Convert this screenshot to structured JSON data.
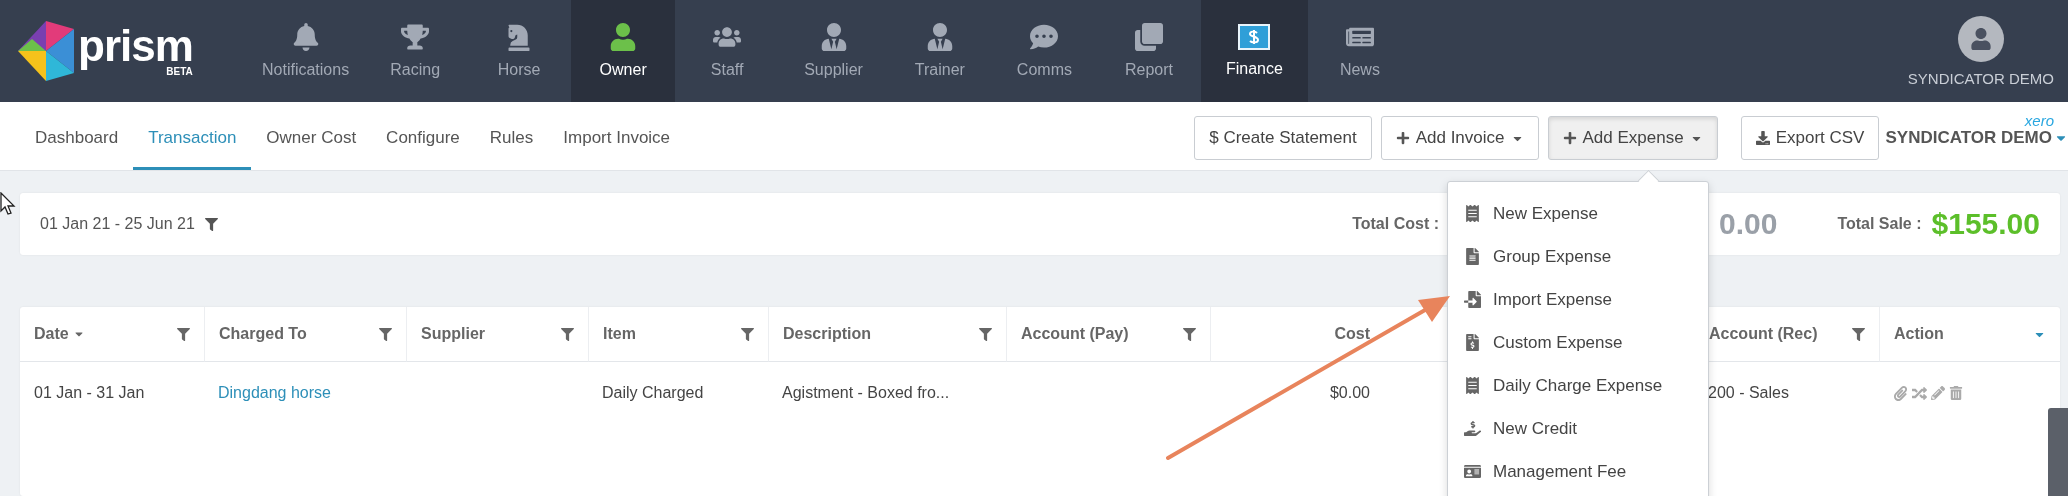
{
  "logo": {
    "name": "prism",
    "badge": "BETA"
  },
  "nav": [
    {
      "label": "Notifications",
      "selected": false
    },
    {
      "label": "Racing",
      "selected": false
    },
    {
      "label": "Horse",
      "selected": false
    },
    {
      "label": "Owner",
      "selected": true
    },
    {
      "label": "Staff",
      "selected": false
    },
    {
      "label": "Supplier",
      "selected": false
    },
    {
      "label": "Trainer",
      "selected": false
    },
    {
      "label": "Comms",
      "selected": false
    },
    {
      "label": "Report",
      "selected": false
    },
    {
      "label": "Finance",
      "selected": true
    },
    {
      "label": "News",
      "selected": false
    }
  ],
  "user": {
    "name": "SYNDICATOR DEMO"
  },
  "tabs": [
    {
      "label": "Dashboard",
      "selected": false
    },
    {
      "label": "Transaction",
      "selected": true
    },
    {
      "label": "Owner Cost",
      "selected": false
    },
    {
      "label": "Configure",
      "selected": false
    },
    {
      "label": "Rules",
      "selected": false
    },
    {
      "label": "Import Invoice",
      "selected": false
    }
  ],
  "actions": [
    {
      "label": "$ Create Statement",
      "kind": "plain",
      "dropdown": false,
      "expanded": false
    },
    {
      "label": "Add Invoice",
      "kind": "add",
      "dropdown": true,
      "expanded": false
    },
    {
      "label": "Add Expense",
      "kind": "add",
      "dropdown": true,
      "expanded": true
    },
    {
      "label": "Export CSV",
      "kind": "export",
      "dropdown": false,
      "expanded": false
    }
  ],
  "xero": {
    "brand": "xero",
    "org": "SYNDICATOR DEMO"
  },
  "expense_menu": [
    "New Expense",
    "Group Expense",
    "Import Expense",
    "Custom Expense",
    "Daily Charge Expense",
    "New Credit",
    "Management Fee"
  ],
  "summary": {
    "date_range": "01 Jan 21 - 25 Jun 21",
    "total_cost_label": "Total Cost :",
    "total_cost": "0.00",
    "total_sale_label": "Total Sale :",
    "total_sale": "$155.00"
  },
  "table": {
    "columns": [
      {
        "label": "Date",
        "kind": "text",
        "filter": true,
        "sorted": true
      },
      {
        "label": "Charged To",
        "kind": "link",
        "filter": true,
        "sorted": false
      },
      {
        "label": "Supplier",
        "kind": "text",
        "filter": true,
        "sorted": false
      },
      {
        "label": "Item",
        "kind": "text",
        "filter": true,
        "sorted": false
      },
      {
        "label": "Description",
        "kind": "text",
        "filter": true,
        "sorted": false
      },
      {
        "label": "Account (Pay)",
        "kind": "text",
        "filter": true,
        "sorted": false
      },
      {
        "label": "Cost",
        "kind": "money",
        "filter": false,
        "sorted": false
      },
      {
        "label": "Account (Rec)",
        "kind": "text",
        "filter": true,
        "sorted": false
      },
      {
        "label": "Action",
        "kind": "actions",
        "filter": false,
        "sorted": false
      }
    ],
    "rows": [
      {
        "cells": [
          "01 Jan - 31 Jan",
          "Dingdang horse",
          null,
          "Daily Charged",
          "Agistment - Boxed fro...",
          null,
          "$0.00",
          "200 - Sales",
          null
        ]
      }
    ]
  }
}
